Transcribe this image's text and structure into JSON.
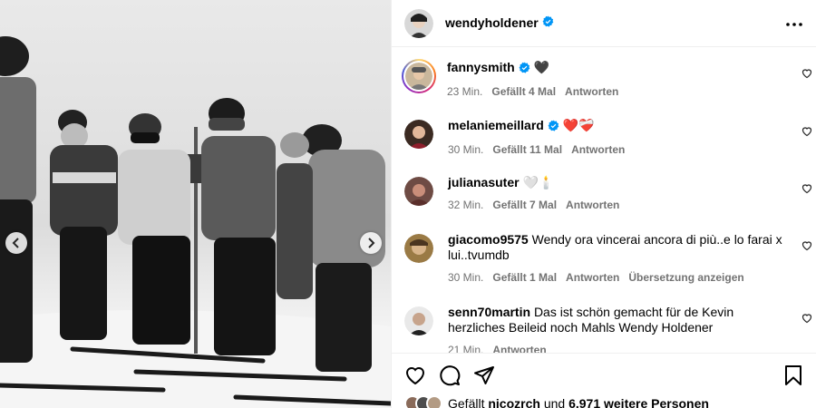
{
  "post": {
    "author": "wendyholdener"
  },
  "comments": [
    {
      "user": "fannysmith",
      "text": "🖤",
      "time": "23 Min.",
      "likes": "Gefällt 4 Mal",
      "reply": "Antworten",
      "verified": true
    },
    {
      "user": "melaniemeillard",
      "text": "❤️❤️‍🩹",
      "time": "30 Min.",
      "likes": "Gefällt 11 Mal",
      "reply": "Antworten",
      "verified": true
    },
    {
      "user": "julianasuter",
      "text": "🤍🕯️",
      "time": "32 Min.",
      "likes": "Gefällt 7 Mal",
      "reply": "Antworten",
      "verified": false
    },
    {
      "user": "giacomo9575",
      "text": "Wendy ora vincerai ancora di più..e lo farai x lui..tvumdb",
      "time": "30 Min.",
      "likes": "Gefällt 1 Mal",
      "reply": "Antworten",
      "translate": "Übersetzung anzeigen",
      "verified": false
    },
    {
      "user": "senn70martin",
      "text": "Das ist schön gemacht für de Kevin herzliches Beileid noch Mahls Wendy Holdener",
      "time": "21 Min.",
      "reply": "Antworten",
      "verified": false
    }
  ],
  "likes": {
    "prefix": "Gefällt",
    "user": "nicozrch",
    "middle": "und",
    "count": "6.971 weitere Personen"
  },
  "colors": {
    "verified": "#0095f6",
    "muted": "#737373",
    "border": "#efefef"
  },
  "icons": [
    "verified-badge-icon",
    "more-options-icon",
    "heart-icon",
    "comment-icon",
    "share-icon",
    "bookmark-icon",
    "chevron-left-icon",
    "chevron-right-icon"
  ]
}
